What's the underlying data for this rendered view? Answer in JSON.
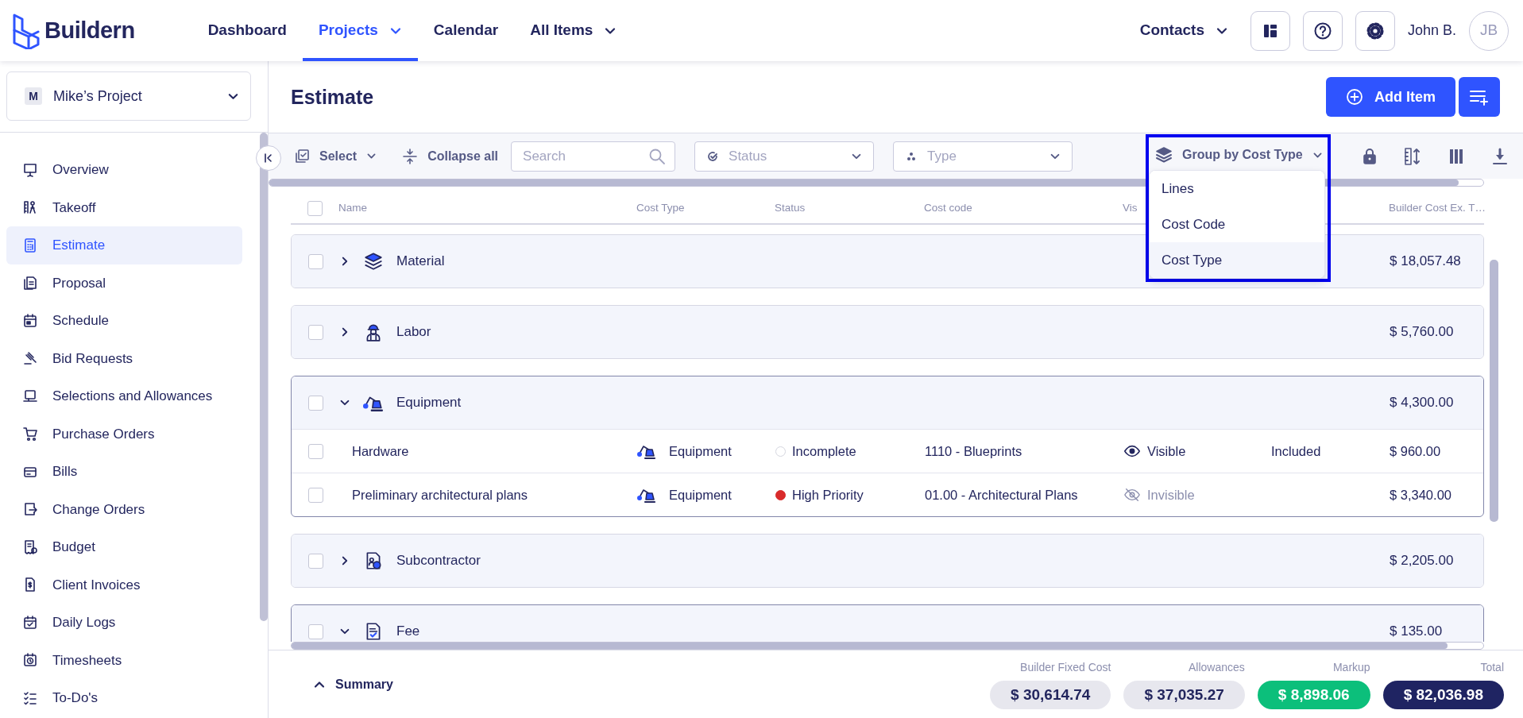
{
  "brand": {
    "name": "Buildern"
  },
  "nav": {
    "items": [
      {
        "label": "Dashboard",
        "selected": false,
        "dropdown": false
      },
      {
        "label": "Projects",
        "selected": true,
        "dropdown": true
      },
      {
        "label": "Calendar",
        "selected": false,
        "dropdown": false
      },
      {
        "label": "All Items",
        "selected": false,
        "dropdown": true
      }
    ],
    "contacts": "Contacts",
    "user": {
      "name": "John B.",
      "initials": "JB"
    }
  },
  "project": {
    "badge": "M",
    "name": "Mike’s Project"
  },
  "sidebar": {
    "items": [
      {
        "label": "Overview",
        "selected": false
      },
      {
        "label": "Takeoff",
        "selected": false
      },
      {
        "label": "Estimate",
        "selected": true
      },
      {
        "label": "Proposal",
        "selected": false
      },
      {
        "label": "Schedule",
        "selected": false
      },
      {
        "label": "Bid Requests",
        "selected": false
      },
      {
        "label": "Selections and Allowances",
        "selected": false
      },
      {
        "label": "Purchase Orders",
        "selected": false
      },
      {
        "label": "Bills",
        "selected": false
      },
      {
        "label": "Change Orders",
        "selected": false
      },
      {
        "label": "Budget",
        "selected": false
      },
      {
        "label": "Client Invoices",
        "selected": false
      },
      {
        "label": "Daily Logs",
        "selected": false
      },
      {
        "label": "Timesheets",
        "selected": false
      },
      {
        "label": "To-Do's",
        "selected": false
      }
    ]
  },
  "page": {
    "title": "Estimate",
    "add_button": "Add Item"
  },
  "toolbar": {
    "select": "Select",
    "collapse": "Collapse all",
    "search": {
      "placeholder": "Search"
    },
    "status_filter": {
      "placeholder": "Status"
    },
    "type_filter": {
      "placeholder": "Type"
    },
    "group_by": {
      "label": "Group by Cost Type",
      "options": [
        {
          "label": "Lines",
          "selected": false
        },
        {
          "label": "Cost Code",
          "selected": false
        },
        {
          "label": "Cost Type",
          "selected": true
        }
      ]
    }
  },
  "table": {
    "header_checked": false,
    "columns": [
      "Name",
      "Cost Type",
      "Status",
      "Cost code",
      "Vis",
      "Builder Cost Ex. T…"
    ],
    "groups": [
      {
        "name": "Material",
        "kind": "material",
        "checked": false,
        "expanded": false,
        "total": "$ 18,057.48"
      },
      {
        "name": "Labor",
        "kind": "labor",
        "checked": false,
        "expanded": false,
        "total": "$ 5,760.00"
      },
      {
        "name": "Equipment",
        "kind": "equipment",
        "checked": false,
        "expanded": true,
        "total": "$ 4,300.00",
        "rows": [
          {
            "name": "Hardware",
            "checked": false,
            "cost_type": {
              "label": "Equipment",
              "kind": "equipment"
            },
            "status": {
              "label": "Incomplete",
              "color": "#d5d6df",
              "filled": false
            },
            "cost_code": "1110 - Blueprints",
            "visibility": {
              "label": "Visible",
              "visible": true
            },
            "column_7": "Included",
            "cost": "$ 960.00"
          },
          {
            "name": "Preliminary architectural plans",
            "checked": false,
            "cost_type": {
              "label": "Equipment",
              "kind": "equipment"
            },
            "status": {
              "label": "High Priority",
              "color": "#d92b2b",
              "filled": true
            },
            "cost_code": "01.00 - Architectural Plans",
            "visibility": {
              "label": "Invisible",
              "visible": false
            },
            "cost": "$ 3,340.00"
          }
        ]
      },
      {
        "name": "Subcontractor",
        "kind": "subcontractor",
        "checked": false,
        "expanded": false,
        "total": "$ 2,205.00"
      },
      {
        "name": "Fee",
        "kind": "fee",
        "checked": false,
        "expanded": true,
        "total": "$ 135.00"
      }
    ]
  },
  "summary": {
    "label": "Summary",
    "totals": [
      {
        "label": "Builder Fixed Cost",
        "value": "$ 30,614.74",
        "color": "#e7e7ee"
      },
      {
        "label": "Allowances",
        "value": "$ 37,035.27",
        "color": "#e7e7ee"
      },
      {
        "label": "Markup",
        "value": "$ 8,898.06",
        "color": "#0cbf7b"
      },
      {
        "label": "Total",
        "value": "$ 82,036.98",
        "color": "#1f2462"
      }
    ]
  }
}
